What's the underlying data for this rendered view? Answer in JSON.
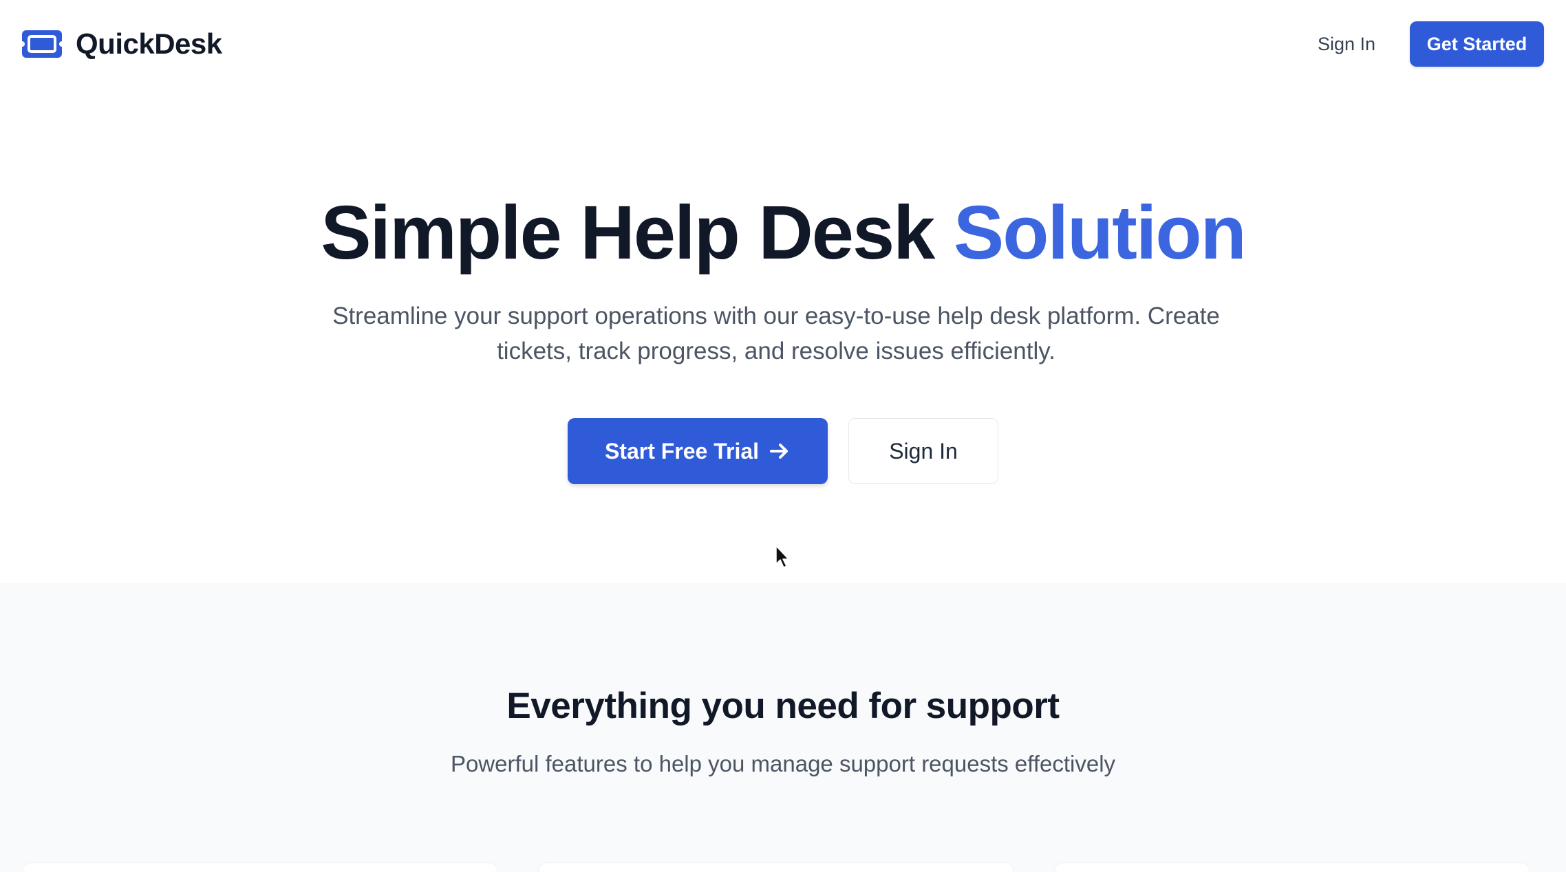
{
  "brand": {
    "name": "QuickDesk",
    "icon": "ticket-icon",
    "color": "#2f5bd8"
  },
  "nav": {
    "sign_in": "Sign In",
    "get_started": "Get Started"
  },
  "hero": {
    "title_main": "Simple Help Desk ",
    "title_accent": "Solution",
    "subtitle": "Streamline your support operations with our easy-to-use help desk platform. Create tickets, track progress, and resolve issues efficiently.",
    "primary_button": "Start Free Trial",
    "primary_button_icon": "arrow-right-icon",
    "secondary_button": "Sign In"
  },
  "features": {
    "title": "Everything you need for support",
    "subtitle": "Powerful features to help you manage support requests effectively"
  },
  "colors": {
    "primary": "#2f5bd8",
    "accent_text": "#3b66e0",
    "heading": "#111827",
    "body_text": "#4b5563",
    "section_bg": "#f9fafb"
  }
}
